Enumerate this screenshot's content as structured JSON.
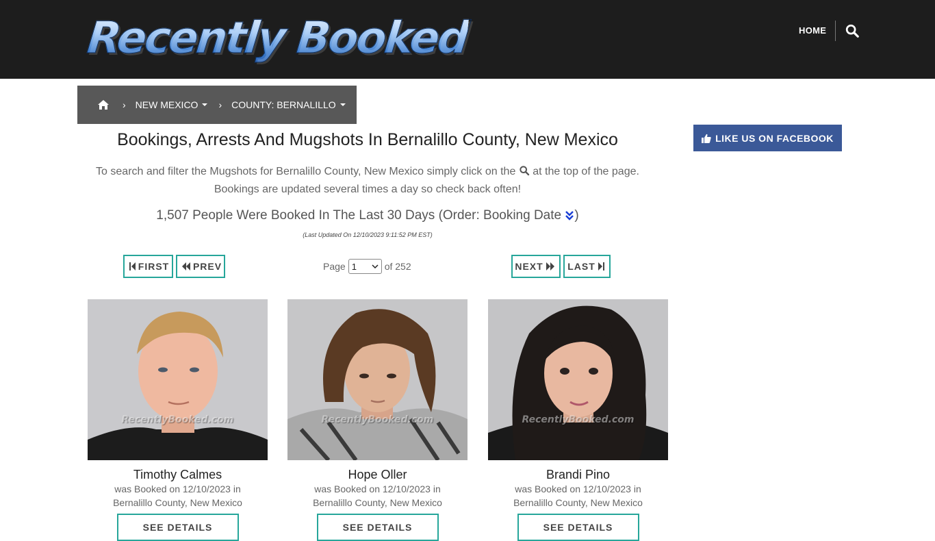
{
  "header": {
    "logo_text": "Recently Booked",
    "nav_home": "HOME",
    "search_icon": "search-icon"
  },
  "breadcrumb": {
    "home_icon": "home-icon",
    "state": "NEW MEXICO",
    "county": "COUNTY: BERNALILLO"
  },
  "facebook": {
    "label": "LIKE US ON FACEBOOK",
    "icon": "thumbs-up-icon",
    "color": "#3b5998"
  },
  "main": {
    "title": "Bookings, Arrests And Mugshots In Bernalillo County, New Mexico",
    "intro_part1": "To search and filter the Mugshots for Bernalillo County, New Mexico simply click on the",
    "intro_part2": "at the top of the page.",
    "intro_line2": "Bookings are updated several times a day so check back often!",
    "count_text": "1,507 People Were Booked In The Last 30 Days (Order: Booking Date",
    "count_close": ")",
    "last_updated": "(Last Updated On 12/10/2023 9:11:52 PM EST)"
  },
  "pagination": {
    "first": "FIRST",
    "prev": "PREV",
    "next": "NEXT",
    "last": "LAST",
    "page_label": "Page",
    "page_value": "1",
    "of_label": "of 252",
    "accent": "#26a69a"
  },
  "people": [
    {
      "name": "Timothy Calmes",
      "booked_line1": "was Booked on 12/10/2023 in",
      "booked_line2": "Bernalillo County, New Mexico",
      "button": "SEE DETAILS",
      "watermark": "RecentlyBooked.com"
    },
    {
      "name": "Hope Oller",
      "booked_line1": "was Booked on 12/10/2023 in",
      "booked_line2": "Bernalillo County, New Mexico",
      "button": "SEE DETAILS",
      "watermark": "RecentlyBooked.com"
    },
    {
      "name": "Brandi Pino",
      "booked_line1": "was Booked on 12/10/2023 in",
      "booked_line2": "Bernalillo County, New Mexico",
      "button": "SEE DETAILS",
      "watermark": "RecentlyBooked.com"
    }
  ]
}
